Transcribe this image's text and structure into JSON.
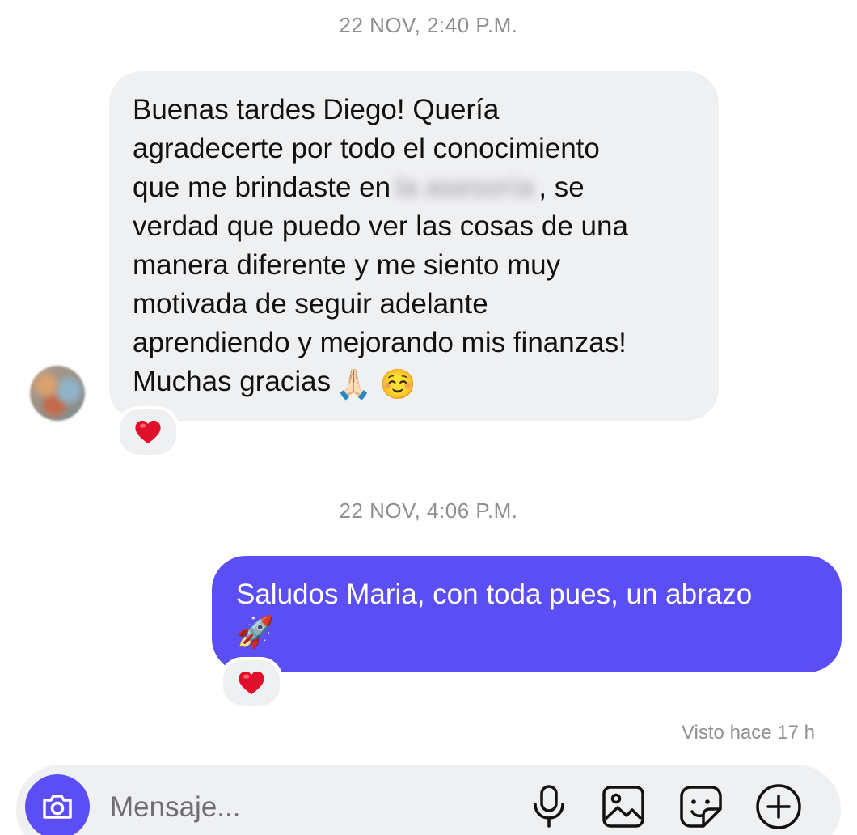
{
  "timestamps": [
    "22 NOV, 2:40 P.M.",
    "22 NOV, 4:06 P.M."
  ],
  "incoming": {
    "lines": [
      "Buenas tardes Diego! Quería",
      "agradecerte por todo el conocimiento",
      "que me brindaste en",
      "verdad que puedo ver las cosas de una",
      "manera diferente y me siento muy",
      "motivada de seguir adelante",
      "aprendiendo y mejorando mis finanzas!",
      "Muchas gracias"
    ],
    "blurred_text": "la asesoría",
    "line3_suffix": ", se",
    "emojis": "🙏🏻 ☺️",
    "reaction": "❤️"
  },
  "outgoing": {
    "lines": [
      "Saludos Maria, con toda pues, un abrazo",
      "🚀"
    ],
    "reaction": "❤️"
  },
  "seen_status": "Visto hace 17 h",
  "composer": {
    "placeholder": "Mensaje...",
    "icons": [
      "camera-icon",
      "microphone-icon",
      "gallery-icon",
      "sticker-icon",
      "plus-icon"
    ]
  },
  "colors": {
    "accent": "#5b4ef5",
    "incoming_bubble": "#eff0f2",
    "timestamp": "#8e8e93",
    "heart": "#e0102a"
  }
}
